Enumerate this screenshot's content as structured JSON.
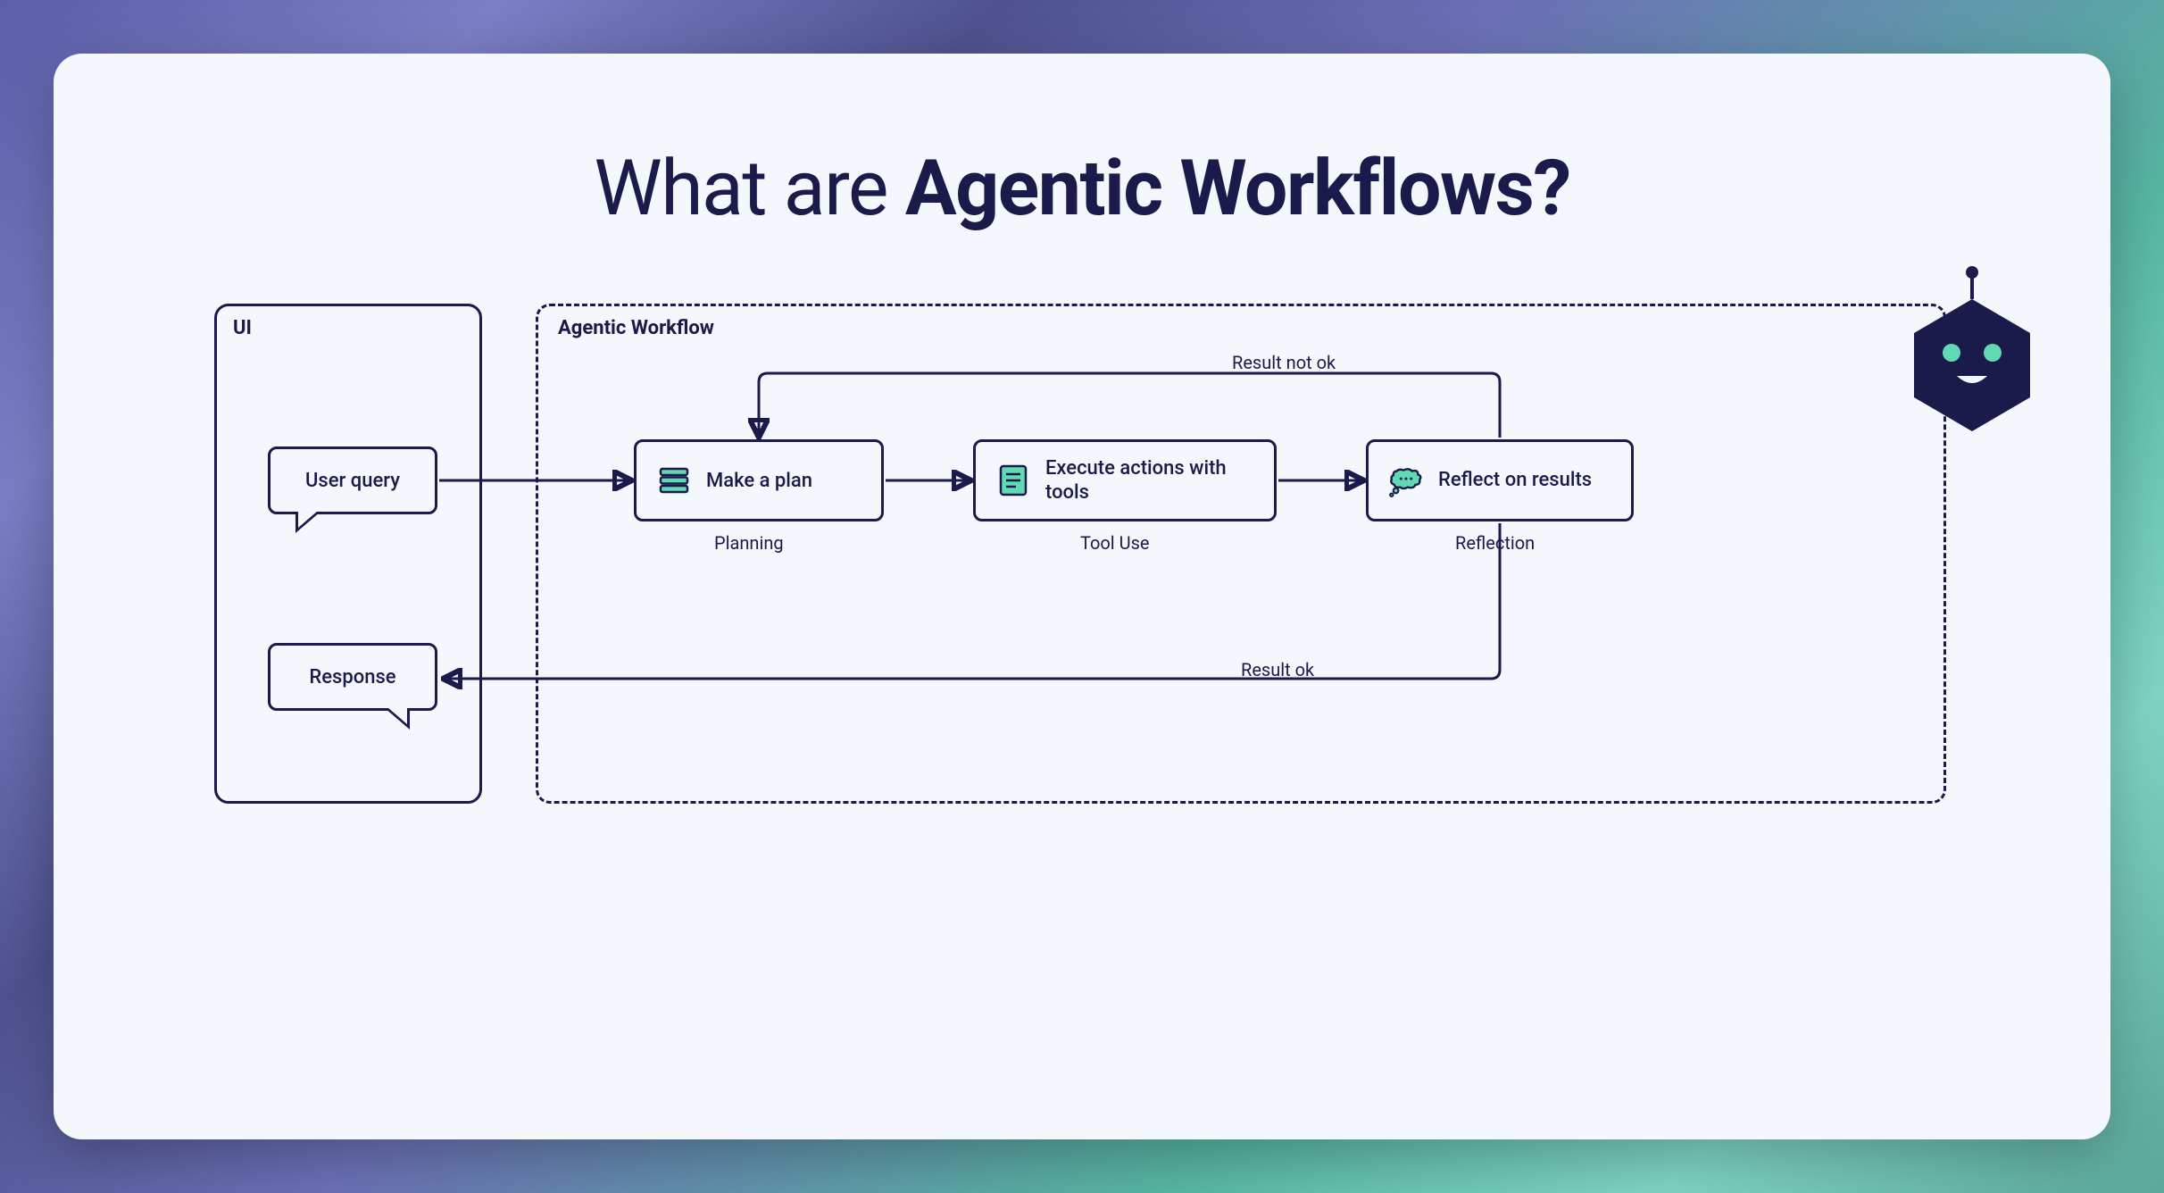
{
  "title": {
    "prefix": "What are ",
    "bold": "Agentic Workflows?"
  },
  "panels": {
    "ui": "UI",
    "agentic": "Agentic Workflow"
  },
  "ui": {
    "query": "User query",
    "response": "Response"
  },
  "steps": {
    "plan": {
      "text": "Make a plan",
      "caption": "Planning"
    },
    "tool": {
      "text": "Execute actions with tools",
      "caption": "Tool Use"
    },
    "reflect": {
      "text": "Reflect on results",
      "caption": "Reflection"
    }
  },
  "edges": {
    "not_ok": "Result not ok",
    "ok": "Result ok"
  },
  "icons": {
    "plan": "list-icon",
    "tool": "document-icon",
    "reflect": "thought-bubble-icon",
    "robot": "robot-hexagon-icon"
  },
  "colors": {
    "ink": "#1a1a4b",
    "accent": "#61d9b3",
    "card": "#f4f8fc"
  }
}
